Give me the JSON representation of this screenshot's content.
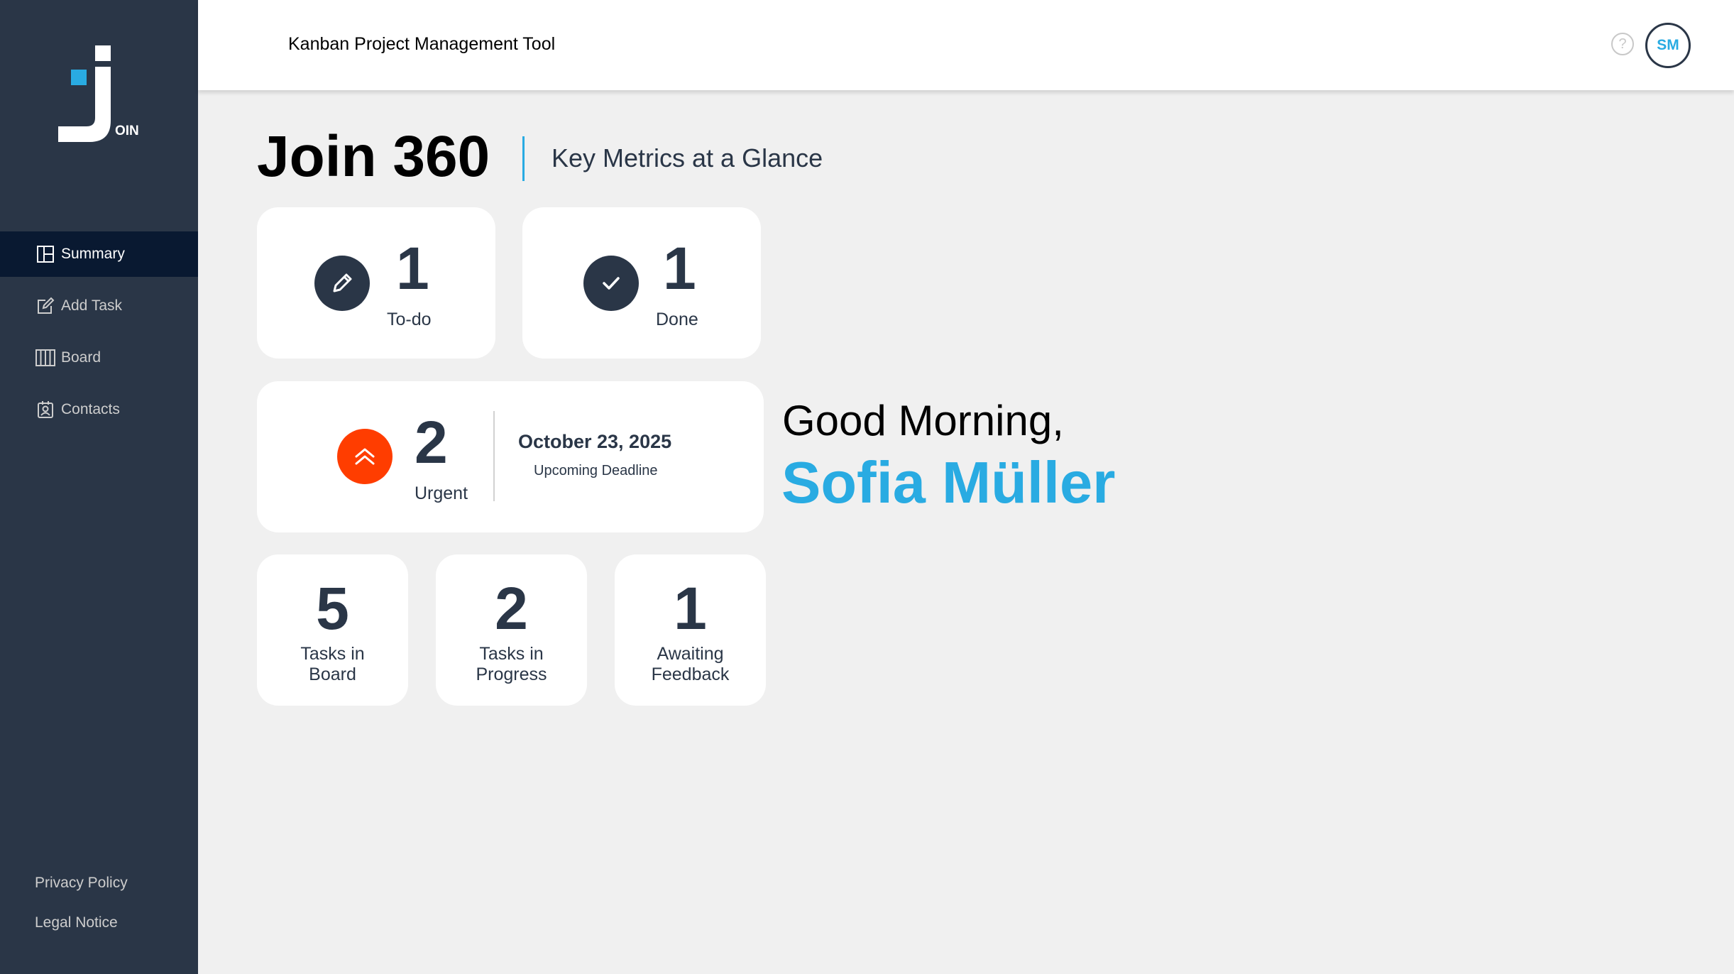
{
  "app": {
    "logo_text": "OIN",
    "header_title": "Kanban Project Management Tool",
    "help_symbol": "?",
    "avatar_initials": "SM"
  },
  "sidebar": {
    "items": [
      {
        "label": "Summary",
        "icon": "summary-icon",
        "active": true
      },
      {
        "label": "Add Task",
        "icon": "add-task-icon",
        "active": false
      },
      {
        "label": "Board",
        "icon": "board-icon",
        "active": false
      },
      {
        "label": "Contacts",
        "icon": "contacts-icon",
        "active": false
      }
    ],
    "footer": {
      "privacy": "Privacy Policy",
      "legal": "Legal Notice"
    }
  },
  "page": {
    "title": "Join 360",
    "subtitle": "Key Metrics at a Glance"
  },
  "metrics": {
    "todo": {
      "value": "1",
      "label": "To-do"
    },
    "done": {
      "value": "1",
      "label": "Done"
    },
    "urgent": {
      "value": "2",
      "label": "Urgent"
    },
    "deadline": {
      "date": "October 23, 2025",
      "label": "Upcoming Deadline"
    },
    "board": {
      "value": "5",
      "label_line1": "Tasks in",
      "label_line2": "Board"
    },
    "progress": {
      "value": "2",
      "label_line1": "Tasks in",
      "label_line2": "Progress"
    },
    "feedback": {
      "value": "1",
      "label_line1": "Awaiting",
      "label_line2": "Feedback"
    }
  },
  "greeting": {
    "text": "Good Morning,",
    "name": "Sofia Müller"
  },
  "colors": {
    "sidebar_bg": "#2a3647",
    "sidebar_active": "#091931",
    "accent": "#29abe2",
    "urgent": "#ff3d00",
    "text_dark": "#2a3647"
  }
}
